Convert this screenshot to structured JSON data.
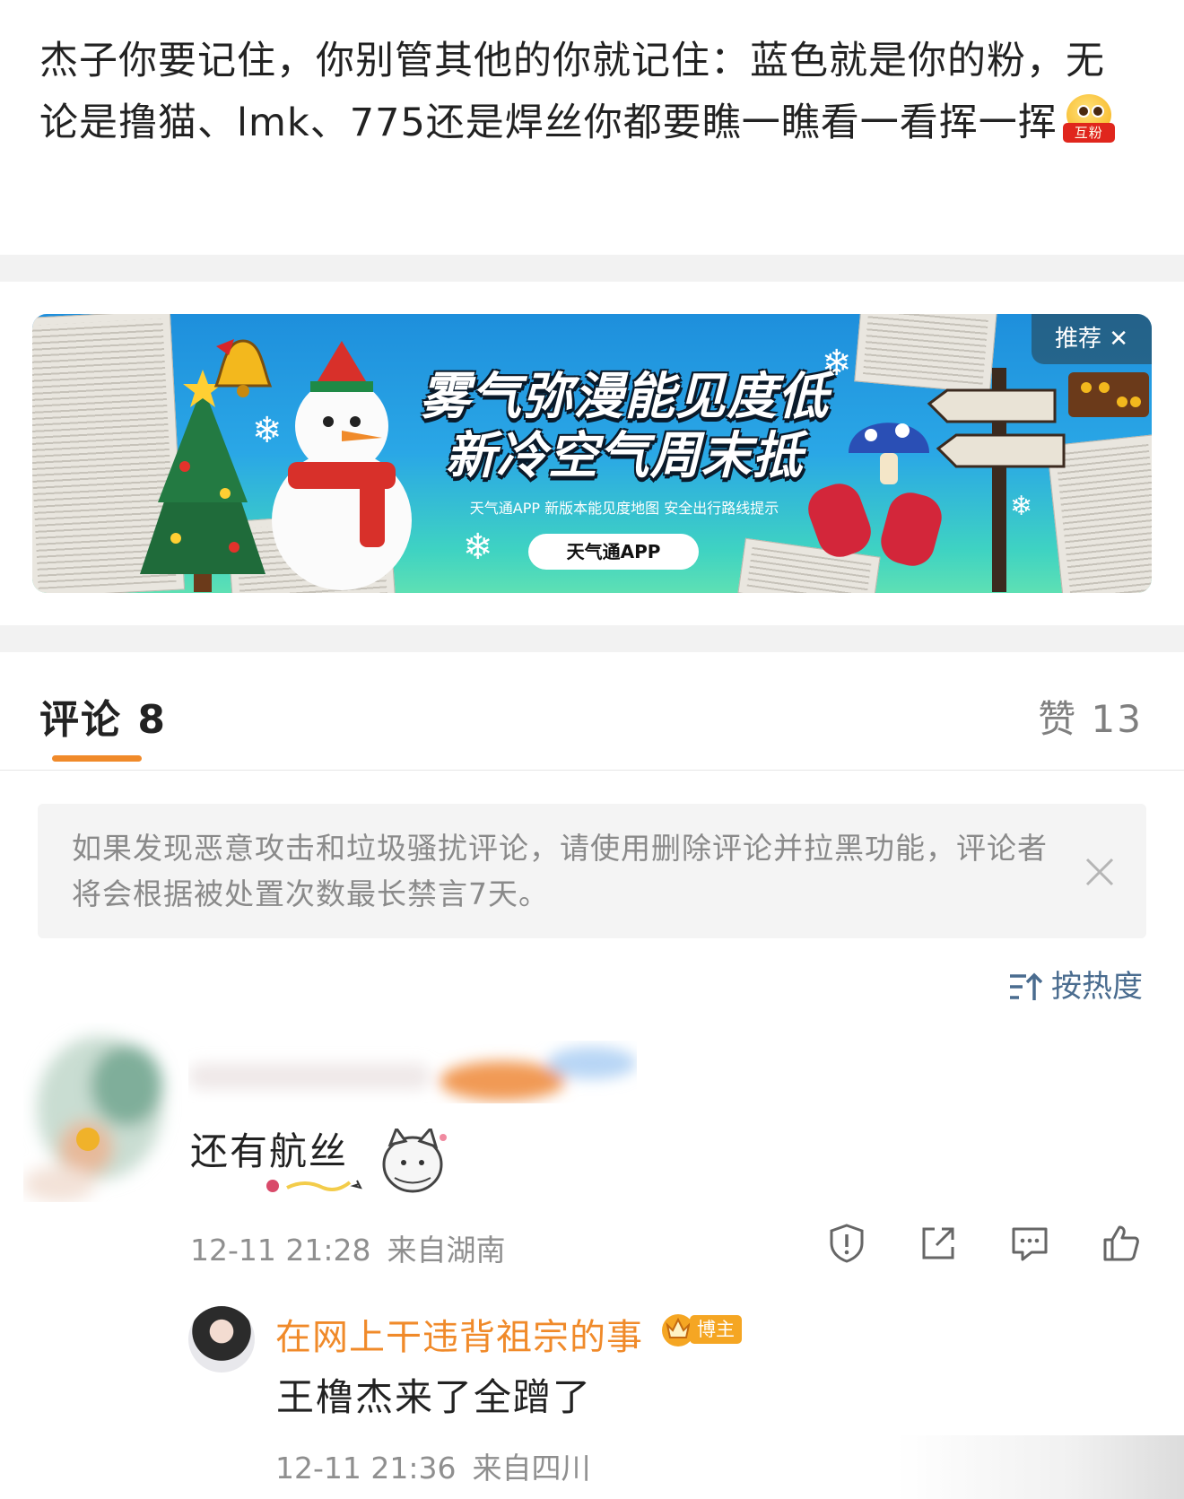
{
  "post": {
    "text": "杰子你要记住，你别管其他的你就记住：蓝色就是你的粉，无论是撸猫、lmk、775还是焊丝你都要瞧一瞧看一看挥一挥",
    "emoji_label": "互粉"
  },
  "ad_banner": {
    "title_line1": "雾气弥漫能见度低",
    "title_line2": "新冷空气周末抵",
    "subtitle": "天气通APP 新版本能见度地图 安全出行路线提示",
    "button_label": "天气通APP",
    "recommend_label": "推荐",
    "colors": {
      "sky_top": "#1e8fdc",
      "sky_bottom": "#5ee0b4"
    }
  },
  "tabs": {
    "comments_label": "评论 8",
    "likes_label": "赞 13",
    "accent": "#f08a2a"
  },
  "notice": {
    "text": "如果发现恶意攻击和垃圾骚扰评论，请使用删除评论并拉黑功能，评论者将会根据被处置次数最长禁言7天。"
  },
  "sort": {
    "label": "按热度"
  },
  "comments": [
    {
      "text": "还有航丝",
      "time": "12-11 21:28",
      "location": "来自湖南",
      "actions": [
        "report-icon",
        "share-icon",
        "reply-icon",
        "like-icon"
      ]
    }
  ],
  "reply": {
    "username": "在网上干违背祖宗的事",
    "badge": "博主",
    "text": "王橹杰来了全蹭了",
    "time": "12-11 21:36",
    "location": "来自四川",
    "name_color": "#f08a2a"
  }
}
